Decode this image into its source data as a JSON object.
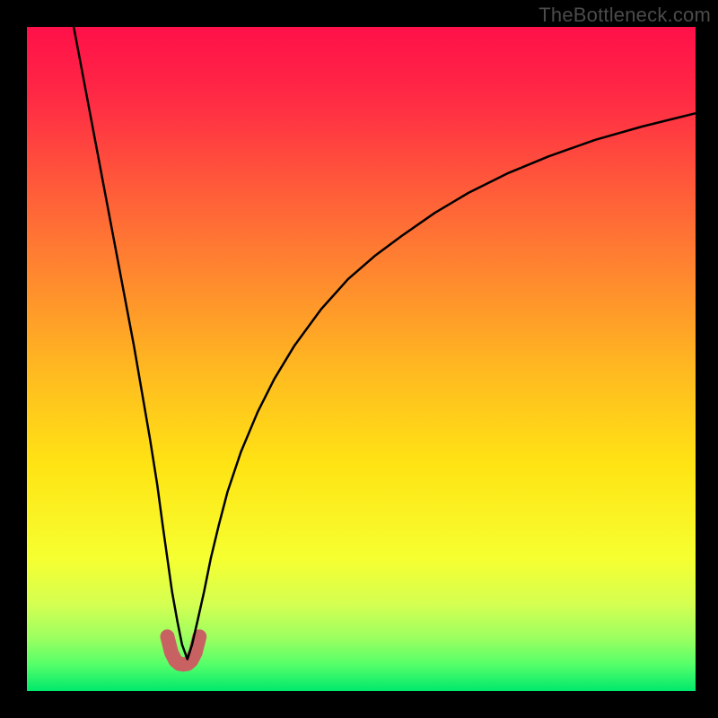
{
  "watermark": "TheBottleneck.com",
  "chart_data": {
    "type": "line",
    "title": "",
    "xlabel": "",
    "ylabel": "",
    "xlim": [
      0,
      100
    ],
    "ylim": [
      0,
      100
    ],
    "background_gradient": {
      "stops": [
        {
          "pos": 0.0,
          "color": "#ff1049"
        },
        {
          "pos": 0.1,
          "color": "#ff2845"
        },
        {
          "pos": 0.24,
          "color": "#ff5a3a"
        },
        {
          "pos": 0.38,
          "color": "#ff8a2e"
        },
        {
          "pos": 0.52,
          "color": "#ffba20"
        },
        {
          "pos": 0.66,
          "color": "#ffe414"
        },
        {
          "pos": 0.8,
          "color": "#f6ff30"
        },
        {
          "pos": 0.87,
          "color": "#d4ff52"
        },
        {
          "pos": 0.92,
          "color": "#9cff60"
        },
        {
          "pos": 0.96,
          "color": "#55ff6a"
        },
        {
          "pos": 1.0,
          "color": "#00e86c"
        }
      ]
    },
    "series": [
      {
        "name": "main-curve",
        "stroke": "#000000",
        "stroke_width": 2.5,
        "x": [
          7.0,
          8.5,
          10.0,
          11.5,
          13.0,
          14.5,
          16.0,
          17.2,
          18.4,
          19.5,
          20.3,
          21.0,
          21.7,
          22.5,
          23.2,
          24.0,
          24.7,
          25.5,
          26.5,
          27.5,
          28.7,
          30.0,
          32.0,
          34.5,
          37.0,
          40.0,
          44.0,
          48.0,
          52.0,
          56.0,
          61.0,
          66.0,
          72.0,
          78.0,
          85.0,
          92.0,
          100.0
        ],
        "y": [
          100.0,
          92.0,
          84.0,
          76.0,
          68.0,
          60.0,
          52.0,
          45.0,
          38.0,
          31.0,
          25.0,
          20.0,
          15.0,
          10.5,
          7.0,
          4.8,
          7.0,
          10.5,
          15.0,
          20.0,
          25.0,
          30.0,
          36.0,
          42.0,
          47.0,
          52.0,
          57.5,
          62.0,
          65.5,
          68.5,
          72.0,
          75.0,
          78.0,
          80.5,
          83.0,
          85.0,
          87.0
        ]
      },
      {
        "name": "trough-highlight",
        "stroke": "#c86262",
        "stroke_width": 16,
        "linecap": "round",
        "x": [
          21.0,
          21.6,
          22.2,
          22.8,
          23.4,
          24.0,
          24.6,
          25.2,
          25.8
        ],
        "y": [
          8.2,
          5.8,
          4.6,
          4.1,
          4.0,
          4.1,
          4.6,
          5.8,
          8.2
        ]
      }
    ]
  }
}
